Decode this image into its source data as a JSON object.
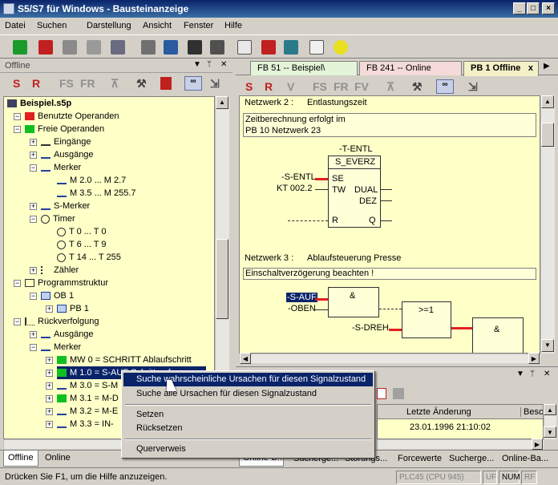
{
  "window": {
    "title": "S5/S7 für Windows - Bausteinanzeige"
  },
  "menu": [
    "Datei",
    "Suchen",
    "Darstellung",
    "Ansicht",
    "Fenster",
    "Hilfe"
  ],
  "left": {
    "header": "Offline",
    "toolbar": {
      "s": "S",
      "r": "R",
      "fs": "FS",
      "fr": "FR"
    },
    "root": "Beispiel.s5p",
    "rows": [
      {
        "label": "Benutzte Operanden"
      },
      {
        "label": "Freie Operanden"
      },
      {
        "label": "Eingänge"
      },
      {
        "label": "Ausgänge"
      },
      {
        "label": "Merker"
      },
      {
        "label": "M 2.0 ... M 2.7"
      },
      {
        "label": "M 3.5 ... M 255.7"
      },
      {
        "label": "S-Merker"
      },
      {
        "label": "Timer"
      },
      {
        "label": "T 0 ... T 0"
      },
      {
        "label": "T 6 ... T 9"
      },
      {
        "label": "T 14 ... T 255"
      },
      {
        "label": "Zähler"
      },
      {
        "label": "Programmstruktur"
      },
      {
        "label": "OB 1"
      },
      {
        "label": "PB 1"
      },
      {
        "label": "Rückverfolgung"
      },
      {
        "label": "Ausgänge"
      },
      {
        "label": "Merker"
      },
      {
        "label": "MW 0 = SCHRITT  Ablaufschritt"
      },
      {
        "label": "M 1.0 = S-AUF  Schritt auf"
      },
      {
        "label": "M 3.0 = S-M"
      },
      {
        "label": "M 3.1 = M-D"
      },
      {
        "label": "M 3.2 = M-E"
      },
      {
        "label": "M 3.3 = IN-"
      }
    ],
    "tabs": [
      "Offline",
      "Online"
    ]
  },
  "right": {
    "tabs": [
      "FB 51 -- Beispiel\\",
      "FB 241 -- Online",
      "PB 1 Offline"
    ],
    "close": "x",
    "toolbar": {
      "s": "S",
      "r": "R",
      "v": "V",
      "fs": "FS",
      "fr": "FR",
      "fv": "FV"
    },
    "nw2": {
      "label": "Netzwerk 2 :",
      "title": "Entlastungszeit",
      "comment1": "Zeitberechnung erfolgt im",
      "comment2": "PB 10 Netzwerk 23"
    },
    "box1": {
      "top": "-T-ENTL",
      "name": "S_EVERZ",
      "se": "SE",
      "tw": "TW",
      "dual": "DUAL",
      "dez": "DEZ",
      "r": "R",
      "q": "Q",
      "in1": "-S-ENTL",
      "in2": "KT 002.2"
    },
    "nw3": {
      "label": "Netzwerk 3 :",
      "title": "Ablaufsteuerung Presse",
      "comment": "Einschaltverzögerung beachten !"
    },
    "box2": {
      "amp": "&",
      "ge": ">=1",
      "amp2": "&",
      "in1": "-S-AUF",
      "in2": "-OBEN",
      "in3": "-S-DREH"
    }
  },
  "lower": {
    "header_partial": "Letzte Änderung",
    "header_more": "Besc",
    "date": "23.01.1996 21:10:02"
  },
  "context_menu": [
    "Suche wahrscheinliche Ursachen für diesen Signalzustand",
    "Suche alle Ursachen für diesen Signalzustand",
    "Setzen",
    "Rücksetzen",
    "Querverweis"
  ],
  "bottom_tabs": [
    "Online-B...",
    "Sucherge...",
    "Störungs...",
    "Forcewerte",
    "Sucherge...",
    "Online-Ba..."
  ],
  "status": {
    "hint": "Drücken Sie F1, um die Hilfe anzuzeigen.",
    "plc": "PLC45 (CPU 945)",
    "uf": "UF",
    "num": "NUM",
    "rf": "RF"
  }
}
